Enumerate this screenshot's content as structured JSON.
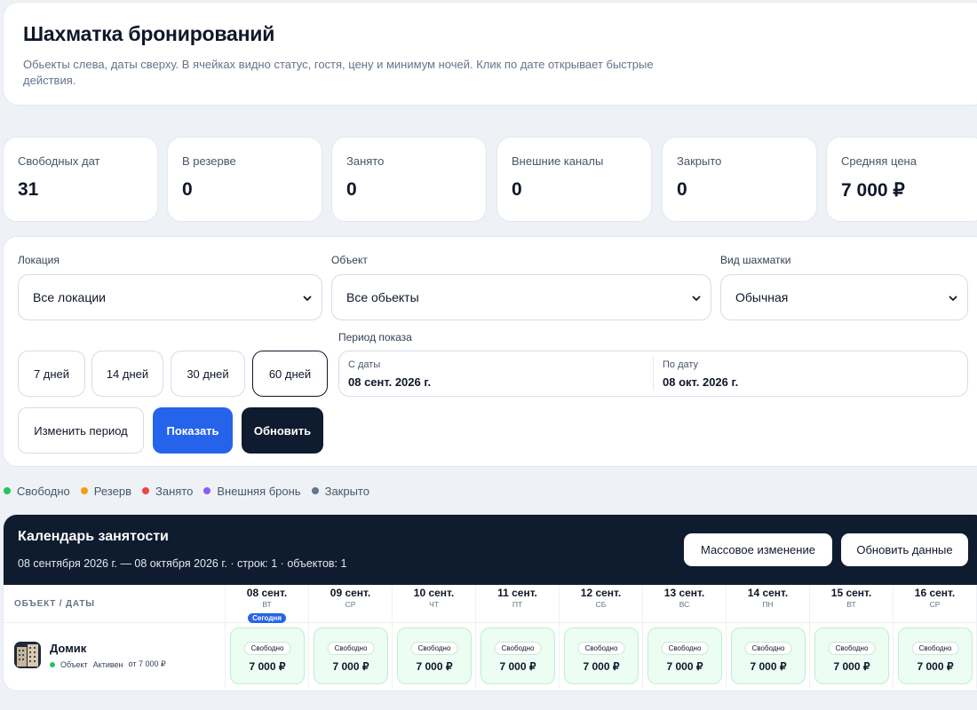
{
  "header": {
    "title": "Шахматка бронирований",
    "subtitle": "Обьекты слева, даты сверху. В ячейках видно статус, гостя, цену и минимум ночей. Клик по дате открывает быстрые действия."
  },
  "stats": [
    {
      "label": "Свободных дат",
      "value": "31"
    },
    {
      "label": "В резерве",
      "value": "0"
    },
    {
      "label": "Занято",
      "value": "0"
    },
    {
      "label": "Внешние каналы",
      "value": "0"
    },
    {
      "label": "Закрыто",
      "value": "0"
    },
    {
      "label": "Средняя цена",
      "value": "7 000 ₽"
    }
  ],
  "filters": {
    "location": {
      "label": "Локация",
      "value": "Все локации"
    },
    "object": {
      "label": "Объект",
      "value": "Все обьекты"
    },
    "view": {
      "label": "Вид шахматки",
      "value": "Обычная"
    },
    "period_buttons": [
      "7 дней",
      "14 дней",
      "30 дней",
      "60 дней"
    ],
    "period_label": "Период показа",
    "from_label": "С даты",
    "from_value": "08 сент. 2026 г.",
    "to_label": "По дату",
    "to_value": "08 окт. 2026 г.",
    "change_period": "Изменить период",
    "show": "Показать",
    "refresh": "Обновить"
  },
  "legend": [
    {
      "label": "Свободно",
      "color": "#22c55e"
    },
    {
      "label": "Резерв",
      "color": "#f59e0b"
    },
    {
      "label": "Занято",
      "color": "#ef4444"
    },
    {
      "label": "Внешняя бронь",
      "color": "#8b5cf6"
    },
    {
      "label": "Закрыто",
      "color": "#64748b"
    }
  ],
  "calendar": {
    "title": "Календарь занятости",
    "subtitle": "08 сентября 2026 г. — 08 октября 2026 г. · строк: 1 · объектов: 1",
    "mass_edit": "Массовое изменение",
    "refresh_data": "Обновить данные",
    "col_header": "ОБЪЕКТ / ДАТЫ",
    "today_badge": "Сегодня",
    "days": [
      {
        "date": "08 сент.",
        "dow": "ВТ"
      },
      {
        "date": "09 сент.",
        "dow": "СР"
      },
      {
        "date": "10 сент.",
        "dow": "ЧТ"
      },
      {
        "date": "11 сент.",
        "dow": "ПТ"
      },
      {
        "date": "12 сент.",
        "dow": "СБ"
      },
      {
        "date": "13 сент.",
        "dow": "ВС"
      },
      {
        "date": "14 сент.",
        "dow": "ПН"
      },
      {
        "date": "15 сент.",
        "dow": "ВТ"
      },
      {
        "date": "16 сент.",
        "dow": "СР"
      }
    ],
    "object": {
      "name": "Домик",
      "type": "Объект",
      "status": "Активен",
      "price_from": "от 7 000 ₽"
    },
    "cells": [
      {
        "status": "Свободно",
        "price": "7 000 ₽"
      },
      {
        "status": "Свободно",
        "price": "7 000 ₽"
      },
      {
        "status": "Свободно",
        "price": "7 000 ₽"
      },
      {
        "status": "Свободно",
        "price": "7 000 ₽"
      },
      {
        "status": "Свободно",
        "price": "7 000 ₽"
      },
      {
        "status": "Свободно",
        "price": "7 000 ₽"
      },
      {
        "status": "Свободно",
        "price": "7 000 ₽"
      },
      {
        "status": "Свободно",
        "price": "7 000 ₽"
      },
      {
        "status": "Свободно",
        "price": "7 000 ₽"
      }
    ]
  }
}
